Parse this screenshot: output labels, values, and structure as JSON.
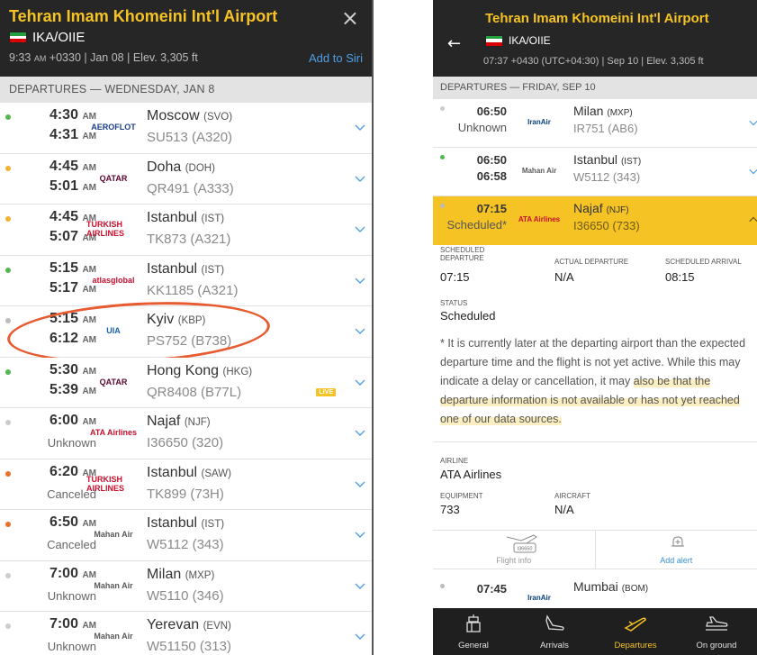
{
  "left": {
    "title": "Tehran Imam Khomeini Int'l Airport",
    "close_icon": "×",
    "code": "IKA/OIIE",
    "info_time": "9:33",
    "info_ampm": "AM",
    "info_rest": " +0330 | Jan 08 | Elev. 3,305 ft",
    "siri": "Add to Siri",
    "section": "DEPARTURES — WEDNESDAY, JAN 8",
    "rows": [
      {
        "t1": "4:30",
        "t1a": "AM",
        "t2": "4:31",
        "t2a": "AM",
        "t2txt": "",
        "airline": "AEROFLOT",
        "dest": "Moscow",
        "code": "(SVO)",
        "flight": "SU513 (A320)",
        "dot": "#52b84f",
        "live": ""
      },
      {
        "t1": "4:45",
        "t1a": "AM",
        "t2": "5:01",
        "t2a": "AM",
        "t2txt": "",
        "airline": "QATAR",
        "dest": "Doha",
        "code": "(DOH)",
        "flight": "QR491 (A333)",
        "dot": "#f3b033",
        "live": ""
      },
      {
        "t1": "4:45",
        "t1a": "AM",
        "t2": "5:07",
        "t2a": "AM",
        "t2txt": "",
        "airline": "TURKISH AIRLINES",
        "dest": "Istanbul",
        "code": "(IST)",
        "flight": "TK873 (A321)",
        "dot": "#f3b033",
        "live": ""
      },
      {
        "t1": "5:15",
        "t1a": "AM",
        "t2": "5:17",
        "t2a": "AM",
        "t2txt": "",
        "airline": "atlasglobal",
        "dest": "Istanbul",
        "code": "(IST)",
        "flight": "KK1185 (A321)",
        "dot": "#52b84f",
        "live": ""
      },
      {
        "t1": "5:15",
        "t1a": "AM",
        "t2": "6:12",
        "t2a": "AM",
        "t2txt": "",
        "airline": "UIA",
        "dest": "Kyiv",
        "code": "(KBP)",
        "flight": "PS752 (B738)",
        "dot": "#bbbbbb",
        "live": ""
      },
      {
        "t1": "5:30",
        "t1a": "AM",
        "t2": "5:39",
        "t2a": "AM",
        "t2txt": "",
        "airline": "QATAR",
        "dest": "Hong Kong",
        "code": "(HKG)",
        "flight": "QR8408 (B77L)",
        "dot": "#52b84f",
        "live": "LIVE"
      },
      {
        "t1": "6:00",
        "t1a": "AM",
        "t2": "",
        "t2a": "",
        "t2txt": "Unknown",
        "airline": "ATA Airlines",
        "dest": "Najaf",
        "code": "(NJF)",
        "flight": "I36650 (320)",
        "dot": "#cccccc",
        "live": ""
      },
      {
        "t1": "6:20",
        "t1a": "AM",
        "t2": "",
        "t2a": "",
        "t2txt": "Canceled",
        "airline": "TURKISH AIRLINES",
        "dest": "Istanbul",
        "code": "(SAW)",
        "flight": "TK899 (73H)",
        "dot": "#e8712a",
        "live": ""
      },
      {
        "t1": "6:50",
        "t1a": "AM",
        "t2": "",
        "t2a": "",
        "t2txt": "Canceled",
        "airline": "Mahan Air",
        "dest": "Istanbul",
        "code": "(IST)",
        "flight": "W5112 (343)",
        "dot": "#e8712a",
        "live": ""
      },
      {
        "t1": "7:00",
        "t1a": "AM",
        "t2": "",
        "t2a": "",
        "t2txt": "Unknown",
        "airline": "Mahan Air",
        "dest": "Milan",
        "code": "(MXP)",
        "flight": "W5110 (346)",
        "dot": "#cccccc",
        "live": ""
      },
      {
        "t1": "7:00",
        "t1a": "AM",
        "t2": "",
        "t2a": "",
        "t2txt": "Unknown",
        "airline": "Mahan Air",
        "dest": "Yerevan",
        "code": "(EVN)",
        "flight": "W51150 (313)",
        "dot": "#cccccc",
        "live": ""
      }
    ]
  },
  "right": {
    "title": "Tehran Imam Khomeini Int'l Airport",
    "code": "IKA/OIIE",
    "info": "07:37 +0430 (UTC+04:30) | Sep 10 | Elev. 3,305 ft",
    "section": "DEPARTURES — FRIDAY, SEP 10",
    "rows": [
      {
        "t1": "06:50",
        "t2": "Unknown",
        "airline": "IranAir",
        "dest": "Milan",
        "code": "(MXP)",
        "flight": "IR751 (AB6)"
      },
      {
        "t1": "06:50",
        "t2": "06:58",
        "airline": "Mahan Air",
        "dest": "Istanbul",
        "code": "(IST)",
        "flight": "W5112 (343)"
      },
      {
        "t1": "07:15",
        "t2": "Scheduled*",
        "airline": "ATA Airlines",
        "dest": "Najaf",
        "code": "(NJF)",
        "flight": "I36650 (733)"
      }
    ],
    "details": {
      "sched_dep_label": "SCHEDULED DEPARTURE",
      "sched_dep": "07:15",
      "actual_dep_label": "ACTUAL DEPARTURE",
      "actual_dep": "N/A",
      "sched_arr_label": "SCHEDULED ARRIVAL",
      "sched_arr": "08:15",
      "status_label": "STATUS",
      "status": "Scheduled",
      "note_a": "* It is currently later at the departing airport than the expected departure time and the flight is not yet active. While this may indicate a delay or cancellation, it may",
      "note_b": "also be that the departure information is not available or has not yet reached one of our data sources.",
      "airline_label": "AIRLINE",
      "airline": "ATA Airlines",
      "equipment_label": "EQUIPMENT",
      "equipment": "733",
      "aircraft_label": "AIRCRAFT",
      "aircraft": "N/A"
    },
    "actions": {
      "flight_info": "Flight info",
      "ticket": "I36650",
      "add_alert": "Add alert"
    },
    "next_row": {
      "t1": "07:45",
      "dest": "Mumbai",
      "code": "(BOM)"
    },
    "tabs": [
      "General",
      "Arrivals",
      "Departures",
      "On ground"
    ]
  }
}
